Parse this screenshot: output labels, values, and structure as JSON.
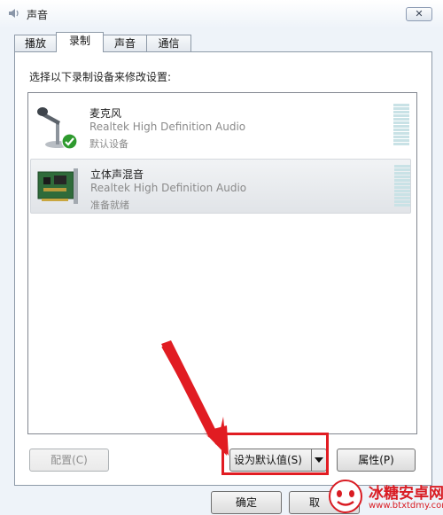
{
  "window": {
    "title": "声音",
    "close_label": "✕"
  },
  "tabs": [
    {
      "label": "播放"
    },
    {
      "label": "录制"
    },
    {
      "label": "声音"
    },
    {
      "label": "通信"
    }
  ],
  "instruction": "选择以下录制设备来修改设置:",
  "devices": [
    {
      "name": "麦克风",
      "driver": "Realtek High Definition Audio",
      "status": "默认设备",
      "icon": "microphone-icon",
      "default": true
    },
    {
      "name": "立体声混音",
      "driver": "Realtek High Definition Audio",
      "status": "准备就绪",
      "icon": "sound-card-icon",
      "selected": true
    }
  ],
  "buttons": {
    "configure": "配置(C)",
    "set_default": "设为默认值(S)",
    "properties": "属性(P)",
    "ok": "确定",
    "cancel": "取"
  },
  "watermark": {
    "title": "冰糖安卓网",
    "url": "www.btxtdmy.com"
  },
  "colors": {
    "highlight": "#e11c22",
    "watermark": "#d91c23",
    "check": "#2e9a2e"
  }
}
